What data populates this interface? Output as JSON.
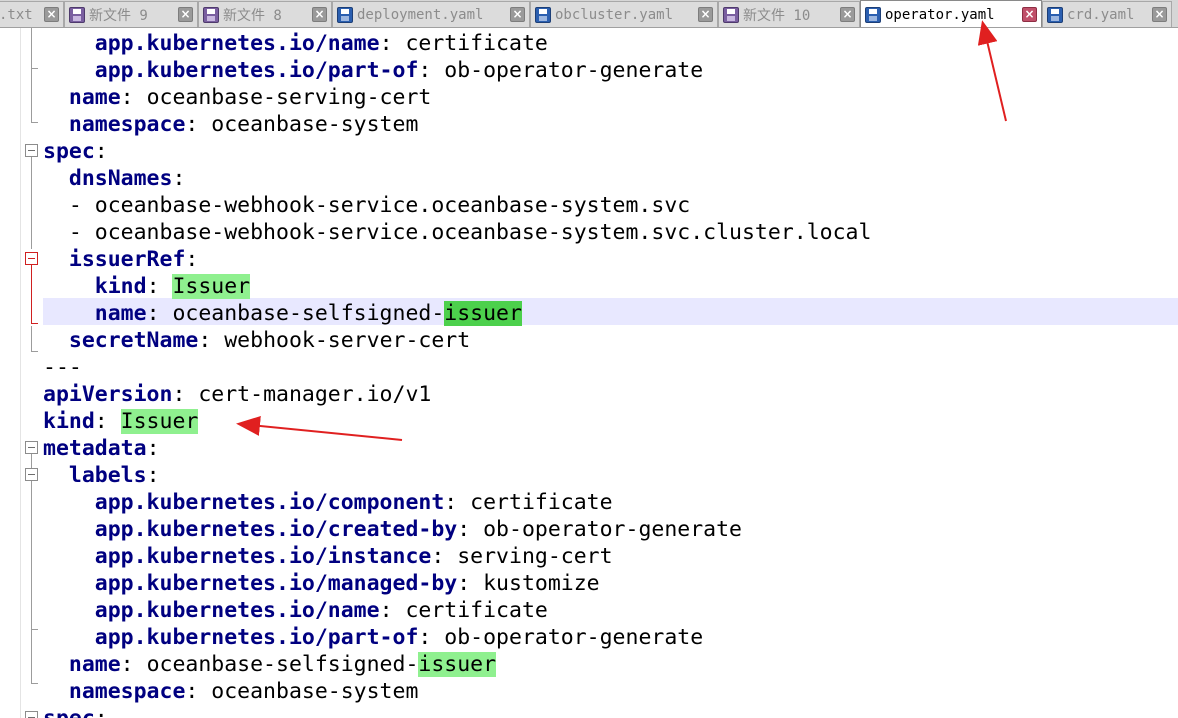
{
  "tabs": [
    {
      "label": ".txt",
      "unsaved": false,
      "active": false
    },
    {
      "label": "新文件 9",
      "unsaved": true,
      "active": false
    },
    {
      "label": "新文件 8",
      "unsaved": true,
      "active": false
    },
    {
      "label": "deployment.yaml",
      "unsaved": false,
      "active": false
    },
    {
      "label": "obcluster.yaml",
      "unsaved": false,
      "active": false
    },
    {
      "label": "新文件 10",
      "unsaved": true,
      "active": false
    },
    {
      "label": "operator.yaml",
      "unsaved": false,
      "active": true
    },
    {
      "label": "crd.yaml",
      "unsaved": false,
      "active": false
    }
  ],
  "lines": [
    {
      "indent": "    ",
      "key": "app.kubernetes.io/name",
      "sep": ": ",
      "value": "certificate"
    },
    {
      "indent": "    ",
      "key": "app.kubernetes.io/part-of",
      "sep": ": ",
      "value": "ob-operator-generate"
    },
    {
      "indent": "  ",
      "key": "name",
      "sep": ": ",
      "value": "oceanbase-serving-cert"
    },
    {
      "indent": "  ",
      "key": "namespace",
      "sep": ": ",
      "value": "oceanbase-system"
    },
    {
      "indent": "",
      "key": "spec",
      "sep": ":",
      "value": ""
    },
    {
      "indent": "  ",
      "key": "dnsNames",
      "sep": ":",
      "value": ""
    },
    {
      "indent": "  ",
      "key": "",
      "sep": "",
      "value": "- oceanbase-webhook-service.oceanbase-system.svc"
    },
    {
      "indent": "  ",
      "key": "",
      "sep": "",
      "value": "- oceanbase-webhook-service.oceanbase-system.svc.cluster.local"
    },
    {
      "indent": "  ",
      "key": "issuerRef",
      "sep": ":",
      "value": ""
    },
    {
      "indent": "    ",
      "key": "kind",
      "sep": ": ",
      "value": "",
      "hl": "Issuer"
    },
    {
      "indent": "    ",
      "key": "name",
      "sep": ": ",
      "value": "oceanbase-selfsigned-",
      "hl2": "issuer"
    },
    {
      "indent": "  ",
      "key": "secretName",
      "sep": ": ",
      "value": "webhook-server-cert"
    },
    {
      "indent": "",
      "key": "",
      "sep": "",
      "value": "---"
    },
    {
      "indent": "",
      "key": "apiVersion",
      "sep": ": ",
      "value": "cert-manager.io/v1"
    },
    {
      "indent": "",
      "key": "kind",
      "sep": ": ",
      "value": "",
      "hl": "Issuer"
    },
    {
      "indent": "",
      "key": "metadata",
      "sep": ":",
      "value": ""
    },
    {
      "indent": "  ",
      "key": "labels",
      "sep": ":",
      "value": ""
    },
    {
      "indent": "    ",
      "key": "app.kubernetes.io/component",
      "sep": ": ",
      "value": "certificate"
    },
    {
      "indent": "    ",
      "key": "app.kubernetes.io/created-by",
      "sep": ": ",
      "value": "ob-operator-generate"
    },
    {
      "indent": "    ",
      "key": "app.kubernetes.io/instance",
      "sep": ": ",
      "value": "serving-cert"
    },
    {
      "indent": "    ",
      "key": "app.kubernetes.io/managed-by",
      "sep": ": ",
      "value": "kustomize"
    },
    {
      "indent": "    ",
      "key": "app.kubernetes.io/name",
      "sep": ": ",
      "value": "certificate"
    },
    {
      "indent": "    ",
      "key": "app.kubernetes.io/part-of",
      "sep": ": ",
      "value": "ob-operator-generate"
    },
    {
      "indent": "  ",
      "key": "name",
      "sep": ": ",
      "value": "oceanbase-selfsigned-",
      "hl": "issuer"
    },
    {
      "indent": "  ",
      "key": "namespace",
      "sep": ": ",
      "value": "oceanbase-system"
    },
    {
      "indent": "",
      "key": "spec",
      "sep": ":",
      "value": ""
    }
  ],
  "colors": {
    "key": "#000080",
    "match": "#8ff08f",
    "selected_match": "#4cd04c",
    "current_line": "#e8e8ff",
    "annotation": "#e02020"
  }
}
